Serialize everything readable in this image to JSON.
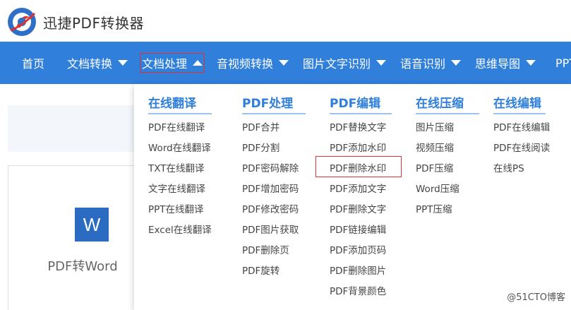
{
  "header": {
    "title": "迅捷PDF转换器"
  },
  "nav": {
    "items": [
      {
        "label": "首页",
        "arrow": ""
      },
      {
        "label": "文档转换",
        "arrow": "down"
      },
      {
        "label": "文档处理",
        "arrow": "up"
      },
      {
        "label": "音视频转换",
        "arrow": "down"
      },
      {
        "label": "图片文字识别",
        "arrow": "down"
      },
      {
        "label": "语音识别",
        "arrow": "down"
      },
      {
        "label": "思维导图",
        "arrow": "down"
      },
      {
        "label": "PPT",
        "arrow": ""
      }
    ]
  },
  "card": {
    "icon_letter": "W",
    "label": "PDF转Word"
  },
  "dropdown": {
    "columns": [
      {
        "title": "在线翻译",
        "items": [
          "PDF在线翻译",
          "Word在线翻译",
          "TXT在线翻译",
          "文字在线翻译",
          "PPT在线翻译",
          "Excel在线翻译"
        ]
      },
      {
        "title": "PDF处理",
        "items": [
          "PDF合并",
          "PDF分割",
          "PDF密码解除",
          "PDF增加密码",
          "PDF修改密码",
          "PDF图片获取",
          "PDF删除页",
          "PDF旋转"
        ]
      },
      {
        "title": "PDF编辑",
        "items": [
          "PDF替换文字",
          "PDF添加水印",
          "PDF删除水印",
          "PDF添加文字",
          "PDF删除文字",
          "PDF链接编辑",
          "PDF添加页码",
          "PDF删除图片",
          "PDF背景颜色"
        ]
      },
      {
        "title": "在线压缩",
        "items": [
          "图片压缩",
          "视频压缩",
          "PDF压缩",
          "Word压缩",
          "PPT压缩"
        ]
      },
      {
        "title": "在线编辑",
        "items": [
          "PDF在线编辑",
          "PDF在线阅读",
          "在线PS"
        ]
      }
    ]
  },
  "watermark": "@51CTO博客",
  "colors": {
    "nav_bg": "#2f7fdb",
    "accent": "#2f7fdb",
    "highlight": "#e03131"
  }
}
